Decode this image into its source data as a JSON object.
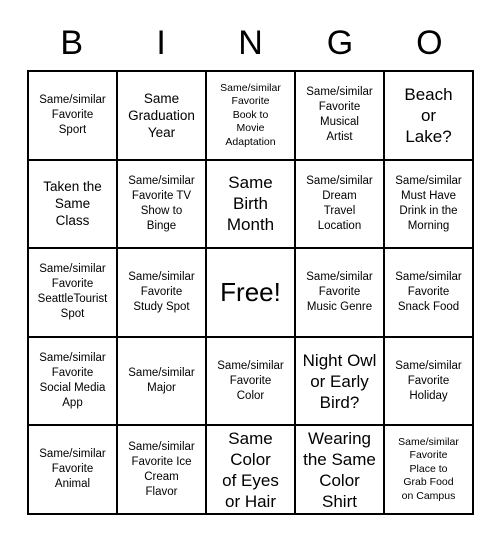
{
  "header": {
    "letters": [
      "B",
      "I",
      "N",
      "G",
      "O"
    ]
  },
  "grid": {
    "rows": 5,
    "columns": 5,
    "border_color": "#000000",
    "background_color": "#ffffff",
    "text_color": "#000000",
    "cells": [
      {
        "text": "Same/similar\nFavorite\nSport",
        "size": "sm"
      },
      {
        "text": "Same\nGraduation\nYear",
        "size": "md"
      },
      {
        "text": "Same/similar\nFavorite\nBook to\nMovie\nAdaptation",
        "size": "xs"
      },
      {
        "text": "Same/similar\nFavorite\nMusical\nArtist",
        "size": "sm"
      },
      {
        "text": "Beach\nor\nLake?",
        "size": "lg"
      },
      {
        "text": "Taken the\nSame\nClass",
        "size": "md"
      },
      {
        "text": "Same/similar\nFavorite TV\nShow to\nBinge",
        "size": "sm"
      },
      {
        "text": "Same\nBirth\nMonth",
        "size": "lg"
      },
      {
        "text": "Same/similar\nDream\nTravel\nLocation",
        "size": "sm"
      },
      {
        "text": "Same/similar\nMust Have\nDrink in the\nMorning",
        "size": "sm"
      },
      {
        "text": "Same/similar\nFavorite\nSeattleTourist\nSpot",
        "size": "sm"
      },
      {
        "text": "Same/similar\nFavorite\nStudy Spot",
        "size": "sm"
      },
      {
        "text": "Free!",
        "size": "xl"
      },
      {
        "text": "Same/similar\nFavorite\nMusic Genre",
        "size": "sm"
      },
      {
        "text": "Same/similar\nFavorite\nSnack Food",
        "size": "sm"
      },
      {
        "text": "Same/similar\nFavorite\nSocial Media\nApp",
        "size": "sm"
      },
      {
        "text": "Same/similar\nMajor",
        "size": "sm"
      },
      {
        "text": "Same/similar\nFavorite\nColor",
        "size": "sm"
      },
      {
        "text": "Night Owl\nor Early\nBird?",
        "size": "lg"
      },
      {
        "text": "Same/similar\nFavorite\nHoliday",
        "size": "sm"
      },
      {
        "text": "Same/similar\nFavorite\nAnimal",
        "size": "sm"
      },
      {
        "text": "Same/similar\nFavorite Ice\nCream\nFlavor",
        "size": "sm"
      },
      {
        "text": "Same\nColor\nof Eyes\nor Hair",
        "size": "lg"
      },
      {
        "text": "Wearing\nthe Same\nColor\nShirt",
        "size": "lg"
      },
      {
        "text": "Same/similar\nFavorite\nPlace to\nGrab Food\non Campus",
        "size": "xs"
      }
    ]
  }
}
